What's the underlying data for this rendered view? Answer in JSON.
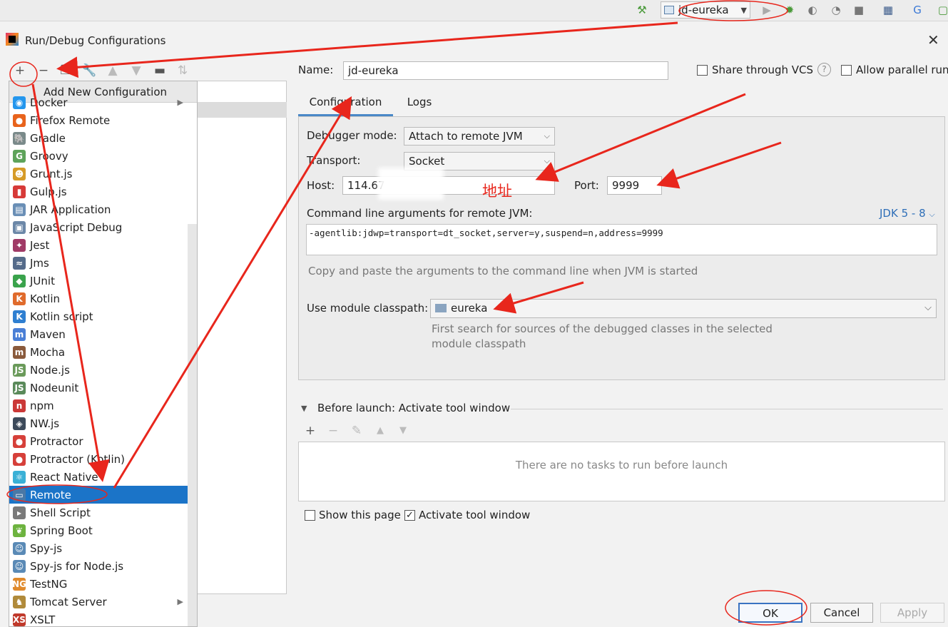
{
  "run_config": {
    "name": "jd-eureka"
  },
  "dialog": {
    "title": "Run/Debug Configurations"
  },
  "popup": {
    "header": "Add New Configuration",
    "items": [
      {
        "label": "Docker",
        "icon": "docker-icon",
        "color": "#2496ed",
        "glyph": "◉",
        "submenu": true
      },
      {
        "label": "Firefox Remote",
        "icon": "firefox-icon",
        "color": "#e8631c",
        "glyph": "●"
      },
      {
        "label": "Gradle",
        "icon": "gradle-icon",
        "color": "#7a8a8a",
        "glyph": "🐘"
      },
      {
        "label": "Groovy",
        "icon": "groovy-icon",
        "color": "#5ea35a",
        "glyph": "G"
      },
      {
        "label": "Grunt.js",
        "icon": "grunt-icon",
        "color": "#d69b27",
        "glyph": "☻"
      },
      {
        "label": "Gulp.js",
        "icon": "gulp-icon",
        "color": "#d73a38",
        "glyph": "▮"
      },
      {
        "label": "JAR Application",
        "icon": "jar-icon",
        "color": "#6a8fb6",
        "glyph": "▤"
      },
      {
        "label": "JavaScript Debug",
        "icon": "js-debug-icon",
        "color": "#6c88a8",
        "glyph": "▣"
      },
      {
        "label": "Jest",
        "icon": "jest-icon",
        "color": "#a03a66",
        "glyph": "✦"
      },
      {
        "label": "Jms",
        "icon": "jms-icon",
        "color": "#556b8a",
        "glyph": "≈"
      },
      {
        "label": "JUnit",
        "icon": "junit-icon",
        "color": "#3aa34c",
        "glyph": "◆"
      },
      {
        "label": "Kotlin",
        "icon": "kotlin-icon",
        "color": "#e06b2c",
        "glyph": "K"
      },
      {
        "label": "Kotlin script",
        "icon": "kotlin-script-icon",
        "color": "#2f7fd1",
        "glyph": "K"
      },
      {
        "label": "Maven",
        "icon": "maven-icon",
        "color": "#4a7fd6",
        "glyph": "m"
      },
      {
        "label": "Mocha",
        "icon": "mocha-icon",
        "color": "#8a5a3c",
        "glyph": "m"
      },
      {
        "label": "Node.js",
        "icon": "nodejs-icon",
        "color": "#6a9a5a",
        "glyph": "JS"
      },
      {
        "label": "Nodeunit",
        "icon": "nodeunit-icon",
        "color": "#5a8a5a",
        "glyph": "JS"
      },
      {
        "label": "npm",
        "icon": "npm-icon",
        "color": "#cb3837",
        "glyph": "n"
      },
      {
        "label": "NW.js",
        "icon": "nwjs-icon",
        "color": "#3c4a5a",
        "glyph": "◈"
      },
      {
        "label": "Protractor",
        "icon": "protractor-icon",
        "color": "#d6403a",
        "glyph": "●"
      },
      {
        "label": "Protractor (Kotlin)",
        "icon": "protractor-kotlin-icon",
        "color": "#d6403a",
        "glyph": "●"
      },
      {
        "label": "React Native",
        "icon": "react-icon",
        "color": "#3ab0d6",
        "glyph": "⚛"
      },
      {
        "label": "Remote",
        "icon": "remote-icon",
        "color": "#4a78a6",
        "glyph": "▭",
        "selected": true
      },
      {
        "label": "Shell Script",
        "icon": "shell-icon",
        "color": "#7a7a7a",
        "glyph": "▸"
      },
      {
        "label": "Spring Boot",
        "icon": "spring-icon",
        "color": "#6db33f",
        "glyph": "❦"
      },
      {
        "label": "Spy-js",
        "icon": "spyjs-icon",
        "color": "#5a8ab6",
        "glyph": "☺"
      },
      {
        "label": "Spy-js for Node.js",
        "icon": "spyjs-node-icon",
        "color": "#5a8ab6",
        "glyph": "☺"
      },
      {
        "label": "TestNG",
        "icon": "testng-icon",
        "color": "#e08a2c",
        "glyph": "NG"
      },
      {
        "label": "Tomcat Server",
        "icon": "tomcat-icon",
        "color": "#b08a3a",
        "glyph": "♞",
        "submenu": true
      },
      {
        "label": "XSLT",
        "icon": "xslt-icon",
        "color": "#c0392b",
        "glyph": "XS"
      }
    ]
  },
  "form": {
    "name_label": "Name:",
    "name_value": "jd-eureka",
    "share_vcs": "Share through VCS",
    "allow_parallel": "Allow parallel run",
    "tabs": {
      "configuration": "Configuration",
      "logs": "Logs"
    },
    "debugger_mode_label": "Debugger mode:",
    "debugger_mode_value": "Attach to remote JVM",
    "transport_label": "Transport:",
    "transport_value": "Socket",
    "host_label": "Host:",
    "host_value": "114.67",
    "host_annotation": "地址",
    "port_label": "Port:",
    "port_value": "9999",
    "cmd_label": "Command line arguments for remote JVM:",
    "jdk_link": "JDK 5 - 8",
    "cmd_value": "-agentlib:jdwp=transport=dt_socket,server=y,suspend=n,address=9999",
    "cmd_hint": "Copy and paste the arguments to the command line when JVM is started",
    "module_label": "Use module classpath:",
    "module_value": "eureka",
    "module_hint_1": "First search for sources of the debugged classes in the selected",
    "module_hint_2": "module classpath",
    "before_launch": "Before launch: Activate tool window",
    "no_tasks": "There are no tasks to run before launch",
    "show_page": "Show this page",
    "activate_tool": "Activate tool window"
  },
  "buttons": {
    "ok": "OK",
    "cancel": "Cancel",
    "apply": "Apply"
  },
  "colors": {
    "selection": "#1b74c8",
    "accent": "#4a88c7",
    "annotation": "#e8261c"
  }
}
